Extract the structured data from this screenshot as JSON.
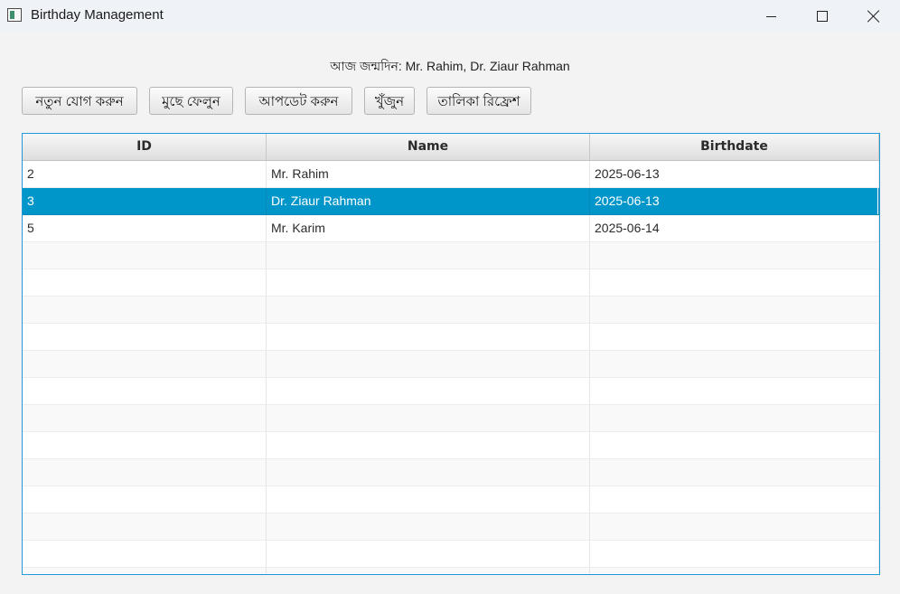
{
  "window": {
    "title": "Birthday Management",
    "icon": "app-window-icon"
  },
  "header": {
    "today_label": "আজ জন্মদিন: Mr. Rahim, Dr. Ziaur Rahman"
  },
  "toolbar": {
    "add": "নতুন যোগ করুন",
    "delete": "মুছে ফেলুন",
    "update": "আপডেট করুন",
    "search": "খুঁজুন",
    "refresh": "তালিকা রিফ্রেশ"
  },
  "table": {
    "columns": [
      "ID",
      "Name",
      "Birthdate"
    ],
    "rows": [
      {
        "id": "2",
        "name": "Mr. Rahim",
        "birthdate": "2025-06-13",
        "selected": false
      },
      {
        "id": "3",
        "name": "Dr. Ziaur Rahman",
        "birthdate": "2025-06-13",
        "selected": true
      },
      {
        "id": "5",
        "name": "Mr. Karim",
        "birthdate": "2025-06-14",
        "selected": false
      }
    ],
    "selection_color": "#0096c9",
    "border_color": "#1e9ad6"
  }
}
